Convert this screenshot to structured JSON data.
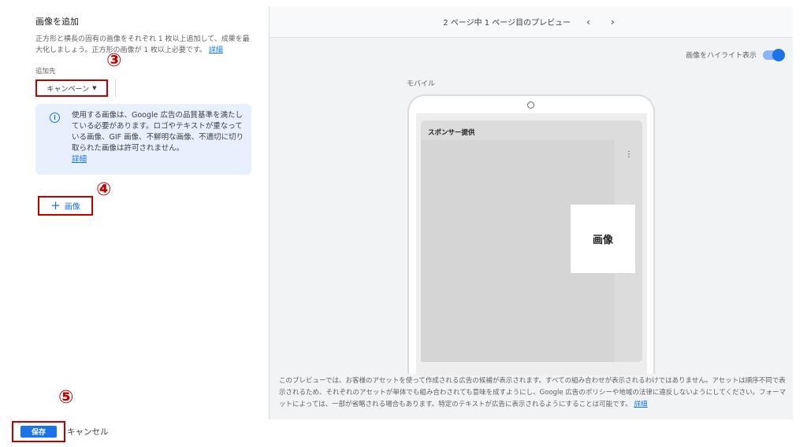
{
  "left": {
    "title": "画像を追加",
    "description": "正方形と横長の固有の画像をそれぞれ 1 枚以上追加して、成果を最大化しましょう。正方形の画像が 1 枚以上必要です。",
    "description_link": "詳細",
    "destination_label": "追加先",
    "destination_value": "キャンペーン",
    "info_text": "使用する画像は、Google 広告の品質基準を満たしている必要があります。ロゴやテキストが重なっている画像、GIF 画像、不鮮明な画像、不適切に切り取られた画像は許可されません。",
    "info_link": "詳細",
    "add_image_label": "画像"
  },
  "annotations": {
    "step3": "③",
    "step4": "④",
    "step5": "⑤"
  },
  "preview": {
    "page_indicator": "2 ページ中 1 ページ目のプレビュー",
    "prev_icon": "chevron-left",
    "next_icon": "chevron-right",
    "highlight_label": "画像をハイライト表示",
    "highlight_on": true,
    "device_label": "モバイル",
    "sponsor_label": "スポンサー提供",
    "image_placeholder_label": "画像",
    "disclaimer": "このプレビューでは、お客様のアセットを使って作成される広告の候補が表示されます。すべての組み合わせが表示されるわけではありません。アセットは順序不同で表示されるため、それぞれのアセットが単体でも組み合わされても意味を成すようにし、Google 広告のポリシーや地域の法律に違反しないようにしてください。フォーマットによっては、一部が省略される場合もあります。特定のテキストが広告に表示されるようにすることは可能です。",
    "disclaimer_link": "詳細"
  },
  "footer": {
    "save_label": "保存",
    "cancel_label": "キャンセル"
  },
  "colors": {
    "accent": "#1a73e8",
    "annotation": "#c00000"
  }
}
